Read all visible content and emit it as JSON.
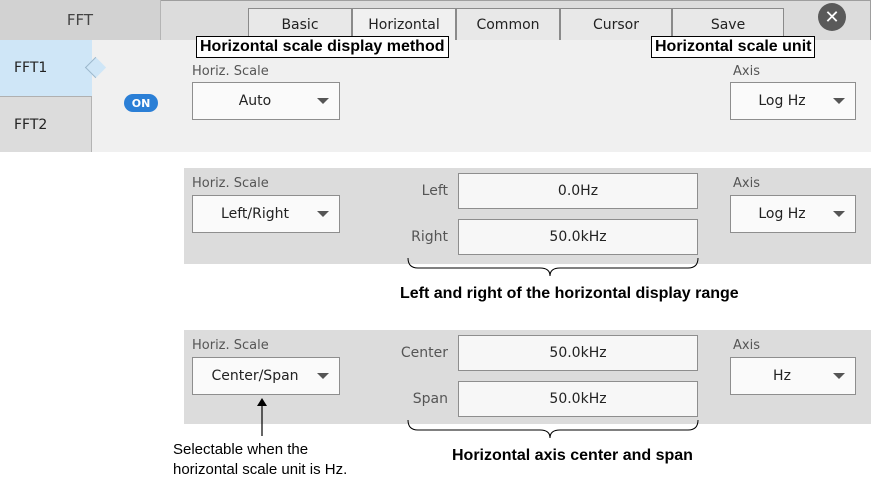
{
  "header": {
    "title": "FFT",
    "tabs": [
      {
        "label": "Basic"
      },
      {
        "label": "Horizontal"
      },
      {
        "label": "Common"
      },
      {
        "label": "Cursor"
      },
      {
        "label": "Save"
      }
    ],
    "close_icon": "close-icon"
  },
  "sidebar": {
    "items": [
      {
        "label": "FFT1"
      },
      {
        "label": "FFT2"
      }
    ]
  },
  "fft1": {
    "on_badge": "ON",
    "horiz_scale_label": "Horiz. Scale",
    "horiz_scale_value": "Auto",
    "axis_label": "Axis",
    "axis_value": "Log Hz"
  },
  "panel_left_right": {
    "horiz_scale_label": "Horiz. Scale",
    "horiz_scale_value": "Left/Right",
    "left_label": "Left",
    "left_value": "0.0Hz",
    "right_label": "Right",
    "right_value": "50.0kHz",
    "axis_label": "Axis",
    "axis_value": "Log Hz"
  },
  "panel_center_span": {
    "horiz_scale_label": "Horiz. Scale",
    "horiz_scale_value": "Center/Span",
    "center_label": "Center",
    "center_value": "50.0kHz",
    "span_label": "Span",
    "span_value": "50.0kHz",
    "axis_label": "Axis",
    "axis_value": "Hz"
  },
  "callouts": {
    "scale_display_method": "Horizontal scale display method",
    "scale_unit": "Horizontal scale unit",
    "left_right_range": "Left and right of the horizontal display range",
    "center_span": "Horizontal axis center and span",
    "selectable_note_line1": "Selectable when the",
    "selectable_note_line2": "horizontal scale unit is Hz."
  }
}
